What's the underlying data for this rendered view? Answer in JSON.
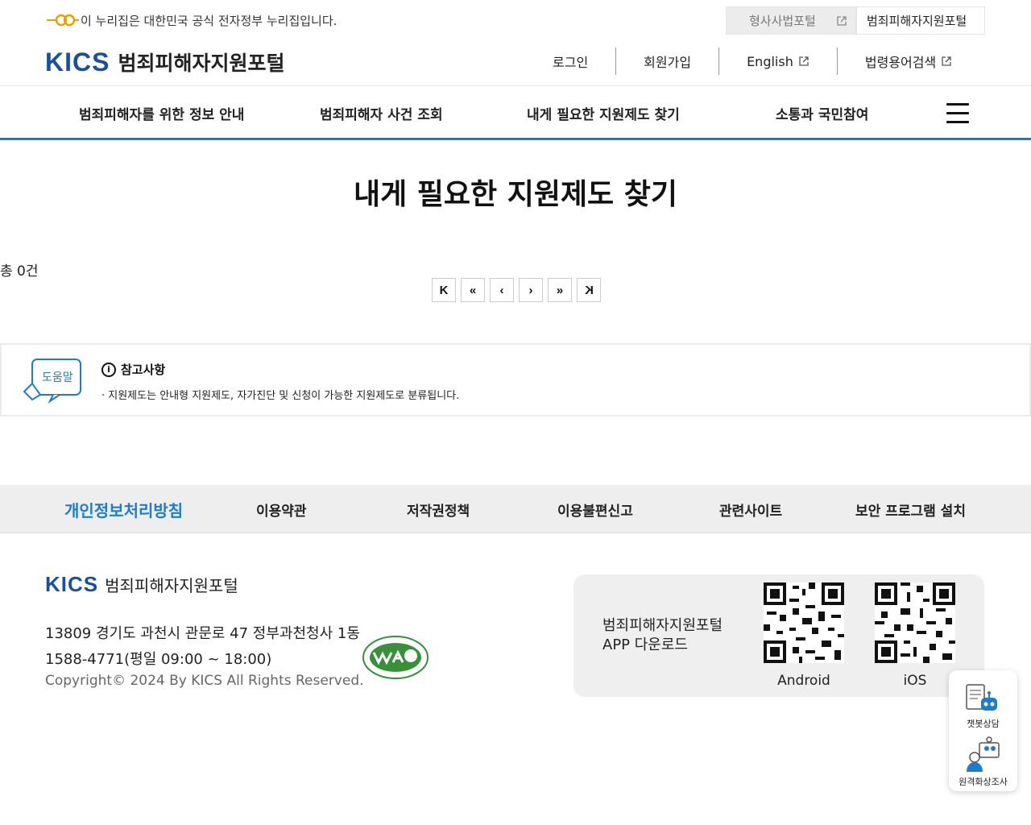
{
  "gov_banner": {
    "text": "이 누리집은 대한민국 공식 전자정부 누리집입니다.",
    "portal_links": [
      {
        "label": "형사사법포털"
      },
      {
        "label": "범죄피해자지원포털"
      }
    ]
  },
  "header": {
    "logo_mark": "KICS",
    "logo_title": "범죄피해자지원포털",
    "util_nav": [
      {
        "label": "로그인"
      },
      {
        "label": "회원가입"
      },
      {
        "label": "English"
      },
      {
        "label": "법령용어검색"
      }
    ]
  },
  "gnb": [
    {
      "label": "범죄피해자를 위한 정보 안내"
    },
    {
      "label": "범죄피해자 사건 조회"
    },
    {
      "label": "내게 필요한 지원제도 찾기"
    },
    {
      "label": "소통과 국민참여"
    }
  ],
  "main": {
    "title": "내게 필요한 지원제도 찾기",
    "total": "총 0건",
    "pagination": [
      "K",
      "«",
      "‹",
      "›",
      "»",
      "K"
    ]
  },
  "note": {
    "help_label": "도움말",
    "heading": "참고사항",
    "text": "· 지원제도는 안내형 지원제도, 자가진단 및 신청이 가능한 지원제도로 분류됩니다."
  },
  "footer_nav": [
    {
      "label": "개인정보처리방침"
    },
    {
      "label": "이용약관"
    },
    {
      "label": "저작권정책"
    },
    {
      "label": "이용불편신고"
    },
    {
      "label": "관련사이트"
    },
    {
      "label": "보안 프로그램 설치"
    }
  ],
  "footer": {
    "logo_mark": "KICS",
    "logo_title": "범죄피해자지원포털",
    "address": "13809 경기도 과천시 관문로 47 정부과천청사 1동",
    "phone": "1588-4771(평일 09:00 ~ 18:00)",
    "copyright": "Copyright© 2024 By KICS All Rights Reserved.",
    "app_line1": "범죄피해자지원포털",
    "app_line2": "APP 다운로드",
    "qr_android": "Android",
    "qr_ios": "iOS"
  },
  "quick_menu": [
    {
      "label": "챗봇상담"
    },
    {
      "label": "원격화상조사"
    }
  ],
  "colors": {
    "brand_blue": "#1a4fa0",
    "accent_blue": "#1f7bcb"
  }
}
